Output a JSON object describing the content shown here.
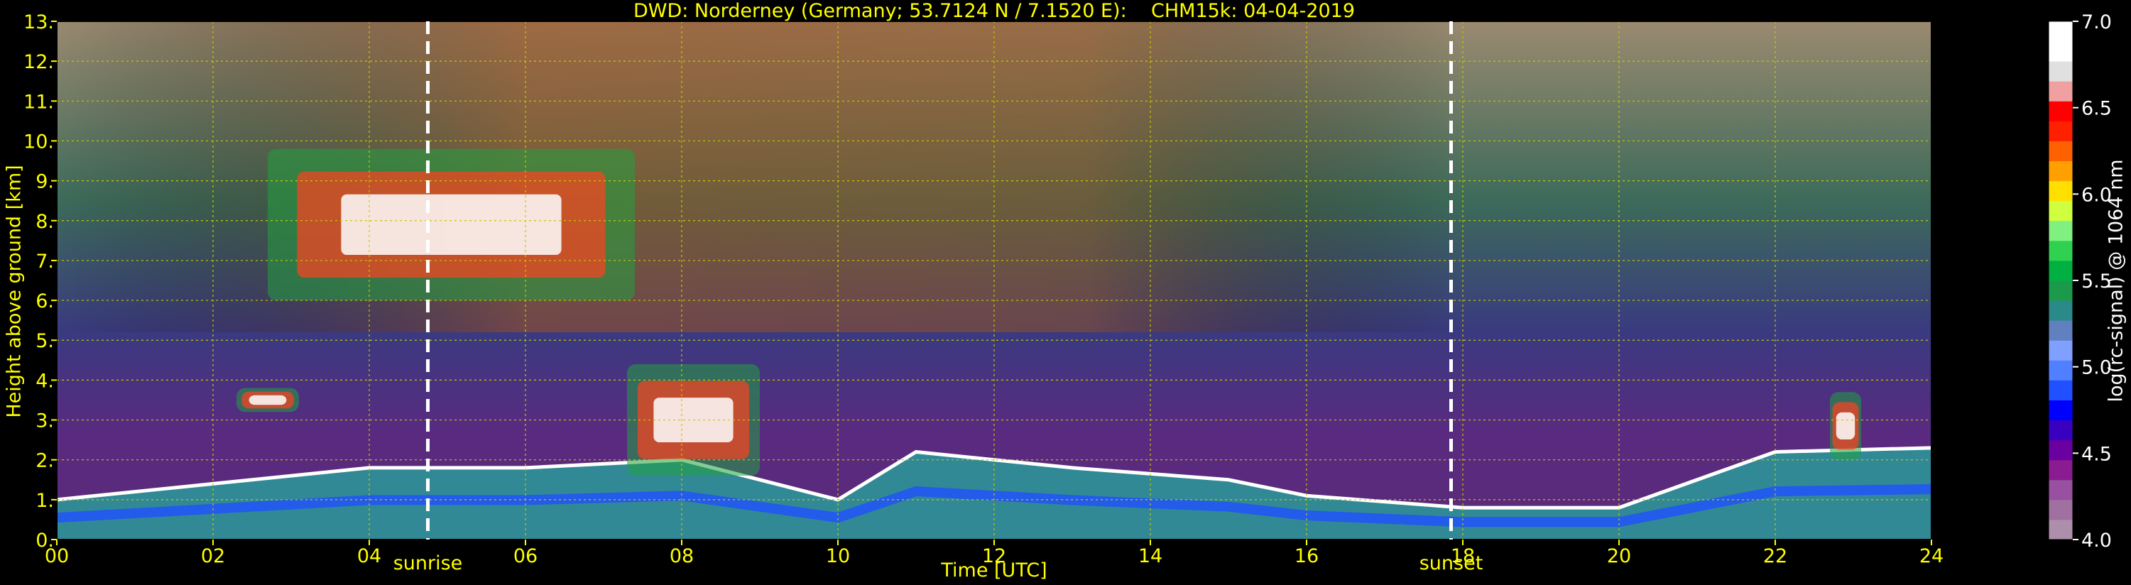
{
  "title": "DWD: Norderney (Germany; 53.7124 N / 7.1520 E):    CHM15k: 04-04-2019",
  "chart_data": {
    "type": "heatmap",
    "title": "DWD: Norderney (Germany; 53.7124 N / 7.1520 E):    CHM15k: 04-04-2019",
    "xlabel": "Time [UTC]",
    "ylabel": "Height above ground [km]",
    "colorbar_label": "log(rc-signal) @ 1064 nm",
    "xlim": [
      0,
      24
    ],
    "ylim": [
      0,
      13
    ],
    "clim": [
      4.0,
      7.0
    ],
    "x_ticks": [
      "00",
      "02",
      "04",
      "06",
      "08",
      "10",
      "12",
      "14",
      "16",
      "18",
      "20",
      "22",
      "24"
    ],
    "y_ticks": [
      "0.",
      "1.",
      "2.",
      "3.",
      "4.",
      "5.",
      "6.",
      "7.",
      "8.",
      "9.",
      "10.",
      "11.",
      "12.",
      "13."
    ],
    "colorbar_ticks": [
      "4.0",
      "4.5",
      "5.0",
      "5.5",
      "6.0",
      "6.5",
      "7.0"
    ],
    "grid": true,
    "annotations": [
      {
        "label": "sunrise",
        "x": 4.75
      },
      {
        "label": "sunset",
        "x": 17.85
      }
    ],
    "boundary_layer_top_km": [
      {
        "x": 0.0,
        "y": 1.0
      },
      {
        "x": 2.0,
        "y": 1.4
      },
      {
        "x": 4.0,
        "y": 1.8
      },
      {
        "x": 6.0,
        "y": 1.8
      },
      {
        "x": 8.0,
        "y": 2.0
      },
      {
        "x": 10.0,
        "y": 1.0
      },
      {
        "x": 11.0,
        "y": 2.2
      },
      {
        "x": 13.0,
        "y": 1.8
      },
      {
        "x": 15.0,
        "y": 1.5
      },
      {
        "x": 16.0,
        "y": 1.1
      },
      {
        "x": 18.0,
        "y": 0.8
      },
      {
        "x": 20.0,
        "y": 0.8
      },
      {
        "x": 22.0,
        "y": 2.2
      },
      {
        "x": 24.0,
        "y": 2.3
      }
    ],
    "cloud_layers": [
      {
        "x_start": 2.7,
        "x_end": 7.4,
        "y_bottom": 6.0,
        "y_top": 9.8
      },
      {
        "x_start": 2.3,
        "x_end": 3.1,
        "y_bottom": 3.2,
        "y_top": 3.8
      },
      {
        "x_start": 7.3,
        "x_end": 9.0,
        "y_bottom": 1.6,
        "y_top": 4.4
      },
      {
        "x_start": 22.7,
        "x_end": 23.1,
        "y_bottom": 2.0,
        "y_top": 3.7
      }
    ]
  }
}
